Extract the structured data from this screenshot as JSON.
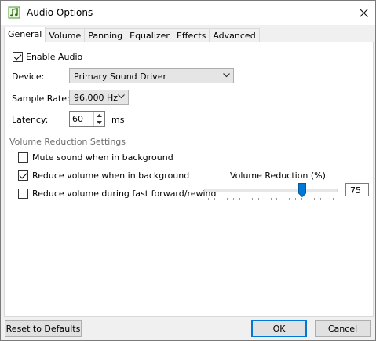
{
  "window": {
    "title": "Audio Options"
  },
  "tabs": [
    "General",
    "Volume",
    "Panning",
    "Equalizer",
    "Effects",
    "Advanced"
  ],
  "general": {
    "enable_audio": {
      "label": "Enable Audio",
      "checked": true
    },
    "device": {
      "label": "Device:",
      "value": "Primary Sound Driver"
    },
    "sample_rate": {
      "label": "Sample Rate:",
      "value": "96,000 Hz"
    },
    "latency": {
      "label": "Latency:",
      "value": "60",
      "unit": "ms"
    }
  },
  "volume_reduction": {
    "group_title": "Volume Reduction Settings",
    "mute_background": {
      "label": "Mute sound when in background",
      "checked": false
    },
    "reduce_background": {
      "label": "Reduce volume when in background",
      "checked": true
    },
    "reduce_fast_forward": {
      "label": "Reduce volume during fast forward/rewind",
      "checked": false
    },
    "slider_label": "Volume Reduction (%)",
    "slider_value": "75"
  },
  "buttons": {
    "reset": "Reset to Defaults",
    "ok": "OK",
    "cancel": "Cancel"
  },
  "colors": {
    "accent": "#0078d7",
    "app_icon": "#4a9a2a"
  }
}
